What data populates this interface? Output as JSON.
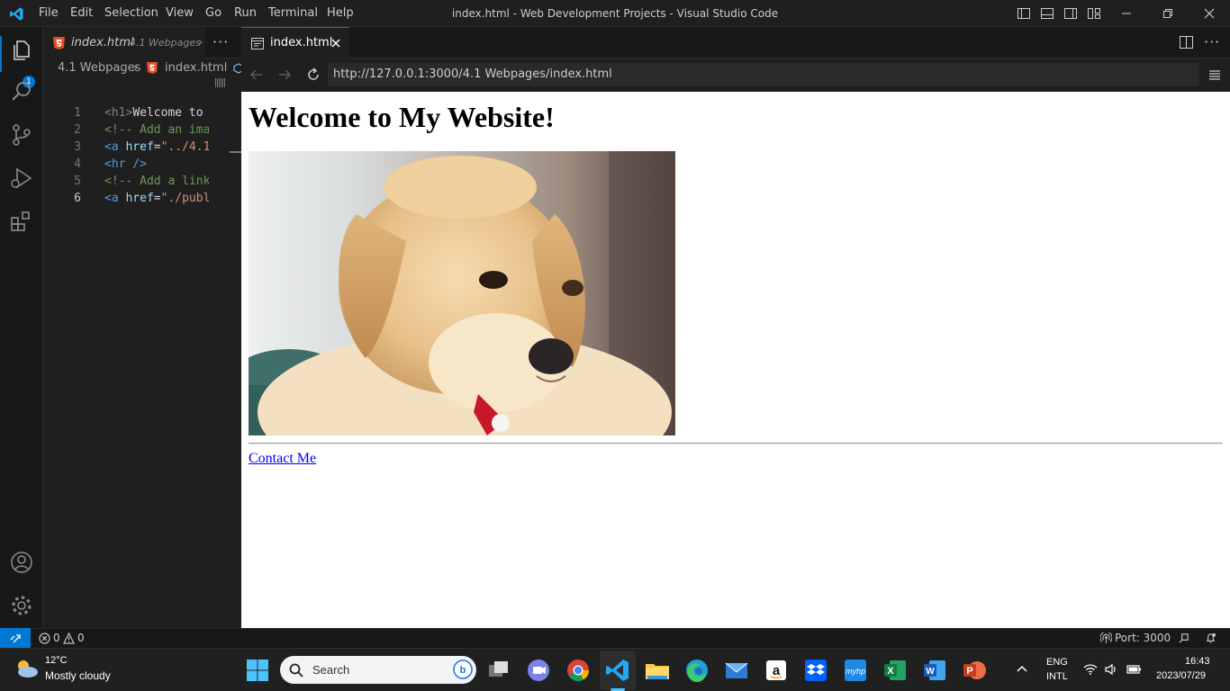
{
  "titlebar": {
    "menu": [
      "File",
      "Edit",
      "Selection",
      "View",
      "Go",
      "Run",
      "Terminal",
      "Help"
    ],
    "window_title": "index.html - Web Development Projects - Visual Studio Code"
  },
  "activity": {
    "explorer_badge": "1"
  },
  "editor1": {
    "tab_name": "index.html",
    "tab_desc": "4.1 Webpages",
    "breadcrumb_folder": "4.1 Webpages",
    "breadcrumb_file": "index.html",
    "lines": [
      {
        "n": "1",
        "segs": [
          {
            "t": "<h1>",
            "c": "#808080"
          },
          {
            "t": "Welcome to",
            "c": "#d4d4d4"
          }
        ]
      },
      {
        "n": "2",
        "segs": [
          {
            "t": "<!-- Add an ima",
            "c": "#6a9955"
          }
        ]
      },
      {
        "n": "3",
        "segs": [
          {
            "t": "<a ",
            "c": "#569cd6"
          },
          {
            "t": "href",
            "c": "#9cdcfe"
          },
          {
            "t": "=",
            "c": "#d4d4d4"
          },
          {
            "t": "\"../4.1",
            "c": "#ce9178"
          }
        ]
      },
      {
        "n": "4",
        "segs": [
          {
            "t": "<hr />",
            "c": "#569cd6"
          }
        ]
      },
      {
        "n": "5",
        "segs": [
          {
            "t": "<!-- Add a link",
            "c": "#6a9955"
          }
        ]
      },
      {
        "n": "6",
        "segs": [
          {
            "t": "<a ",
            "c": "#569cd6"
          },
          {
            "t": "href",
            "c": "#9cdcfe"
          },
          {
            "t": "=",
            "c": "#d4d4d4"
          },
          {
            "t": "\"./publ",
            "c": "#ce9178"
          }
        ]
      }
    ]
  },
  "editor2": {
    "tab_name": "index.html",
    "url": "http://127.0.0.1:3000/4.1 Webpages/index.html",
    "page": {
      "heading": "Welcome to My Website!",
      "link_text": "Contact Me"
    }
  },
  "statusbar": {
    "errors": "0",
    "warnings": "0",
    "port": "Port: 3000"
  },
  "taskbar": {
    "weather_temp": "12°C",
    "weather_desc": "Mostly cloudy",
    "search_placeholder": "Search",
    "lang": "ENG",
    "layout": "INTL",
    "time": "16:43",
    "date": "2023/07/29"
  },
  "colors": {
    "accent": "#0078d4",
    "link": "#0000ee"
  }
}
